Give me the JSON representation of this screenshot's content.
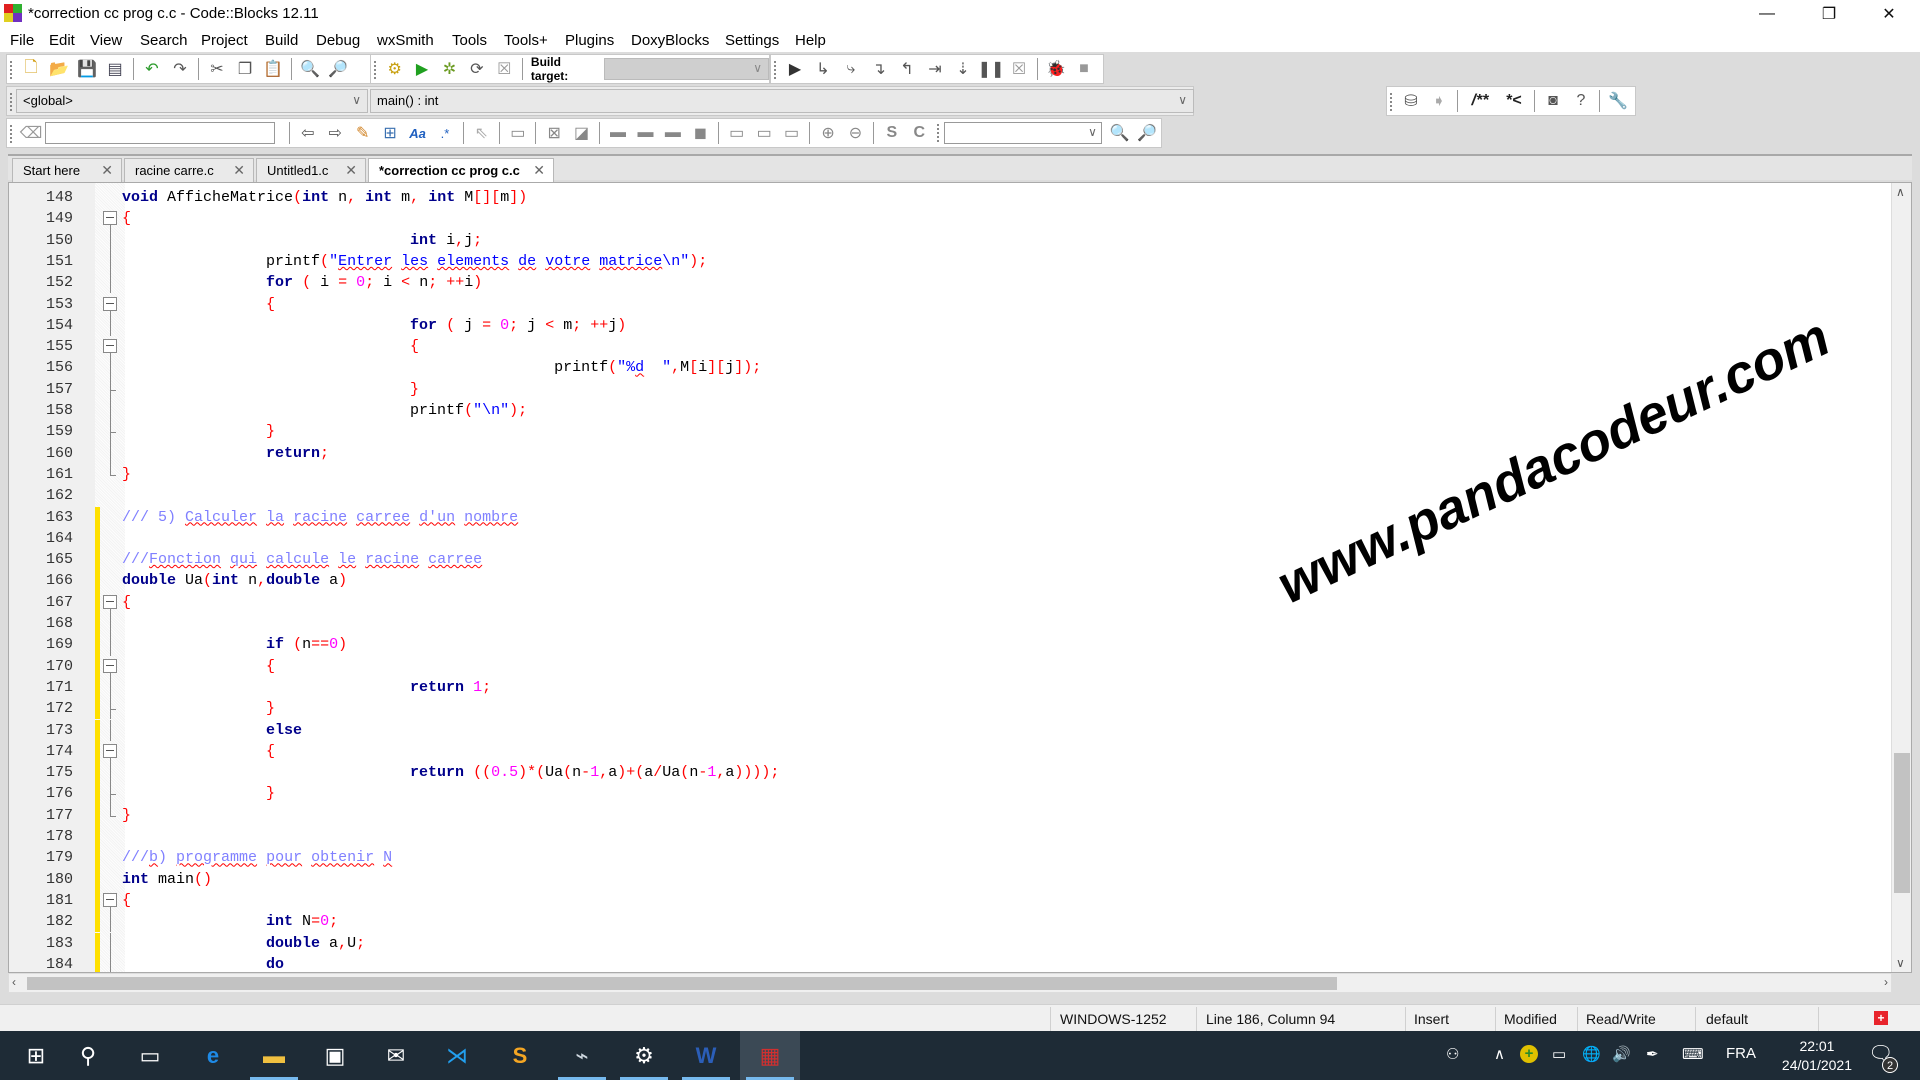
{
  "window": {
    "title": "*correction cc prog c.c - Code::Blocks 12.11",
    "minimize": "—",
    "maximize": "❐",
    "close": "✕"
  },
  "menu": [
    "File",
    "Edit",
    "View",
    "Search",
    "Project",
    "Build",
    "Debug",
    "wxSmith",
    "Tools",
    "Tools+",
    "Plugins",
    "DoxyBlocks",
    "Settings",
    "Help"
  ],
  "toolbar": {
    "build_target_label": "Build target:",
    "build_target_value": "",
    "scope_combo": "<global>",
    "function_combo": "main() : int",
    "search_value": "",
    "doxy_block_label": "/**",
    "doxy_line_label": "*<"
  },
  "tabs": [
    {
      "label": "Start here",
      "active": false
    },
    {
      "label": "racine carre.c",
      "active": false
    },
    {
      "label": "Untitled1.c",
      "active": false
    },
    {
      "label": "*correction cc prog c.c",
      "active": true
    }
  ],
  "tab_close": "✕",
  "editor": {
    "lines": [
      {
        "n": "148",
        "mark": false,
        "fold": "none",
        "html": "<span class='ty'>void</span> <span class='id'>AfficheMatrice</span><span class='op'>(</span><span class='ty'>int</span> n<span class='op'>,</span> <span class='ty'>int</span> m<span class='op'>,</span> <span class='ty'>int</span> M<span class='op'>[][</span>m<span class='op'>])</span>"
      },
      {
        "n": "149",
        "mark": false,
        "fold": "open",
        "html": "<span class='op'>{</span>"
      },
      {
        "n": "150",
        "mark": false,
        "fold": "line",
        "html": "                                <span class='ty'>int</span> i<span class='op'>,</span>j<span class='op'>;</span>"
      },
      {
        "n": "151",
        "mark": false,
        "fold": "line",
        "html": "                printf<span class='op'>(</span><span class='str'>\"<span class='sp'>Entrer</span> <span class='sp'>les</span> <span class='sp'>elements</span> <span class='sp'>de</span> <span class='sp'>votre</span> <span class='sp'>matrice</span>\\n\"</span><span class='op'>);</span>"
      },
      {
        "n": "152",
        "mark": false,
        "fold": "line",
        "html": "                <span class='kw'>for</span> <span class='op'>(</span> i <span class='op'>=</span> <span class='num'>0</span><span class='op'>;</span> i <span class='op'>&lt;</span> n<span class='op'>;</span> <span class='op'>++</span>i<span class='op'>)</span>"
      },
      {
        "n": "153",
        "mark": false,
        "fold": "open",
        "html": "                <span class='op'>{</span>"
      },
      {
        "n": "154",
        "mark": false,
        "fold": "line",
        "html": "                                <span class='kw'>for</span> <span class='op'>(</span> j <span class='op'>=</span> <span class='num'>0</span><span class='op'>;</span> j <span class='op'>&lt;</span> m<span class='op'>;</span> <span class='op'>++</span>j<span class='op'>)</span>"
      },
      {
        "n": "155",
        "mark": false,
        "fold": "open",
        "html": "                                <span class='op'>{</span>"
      },
      {
        "n": "156",
        "mark": false,
        "fold": "line",
        "html": "                                                printf<span class='op'>(</span><span class='str'>\"%<span class='sp'>d</span>  \"</span><span class='op'>,</span>M<span class='op'>[</span>i<span class='op'>][</span>j<span class='op'>]);</span>"
      },
      {
        "n": "157",
        "mark": false,
        "fold": "end",
        "html": "                                <span class='op'>}</span>"
      },
      {
        "n": "158",
        "mark": false,
        "fold": "line",
        "html": "                                printf<span class='op'>(</span><span class='str'>\"\\n\"</span><span class='op'>);</span>"
      },
      {
        "n": "159",
        "mark": false,
        "fold": "end",
        "html": "                <span class='op'>}</span>"
      },
      {
        "n": "160",
        "mark": false,
        "fold": "line",
        "html": "                <span class='kw'>return</span><span class='op'>;</span>"
      },
      {
        "n": "161",
        "mark": false,
        "fold": "last",
        "html": "<span class='op'>}</span>"
      },
      {
        "n": "162",
        "mark": false,
        "fold": "none",
        "html": ""
      },
      {
        "n": "163",
        "mark": true,
        "fold": "none",
        "html": "<span class='cm'>/// 5) <span class='sp'>Calculer</span> <span class='sp'>la</span> <span class='sp'>racine</span> <span class='sp'>carree</span> <span class='sp'>d'un</span> <span class='sp'>nombre</span></span>"
      },
      {
        "n": "164",
        "mark": true,
        "fold": "none",
        "html": ""
      },
      {
        "n": "165",
        "mark": true,
        "fold": "none",
        "html": "<span class='cm'>///<span class='sp'>Fonction</span> <span class='sp'>qui</span> <span class='sp'>calcule</span> <span class='sp'>le</span> <span class='sp'>racine</span> <span class='sp'>carree</span></span>"
      },
      {
        "n": "166",
        "mark": true,
        "fold": "none",
        "html": "<span class='ty'>double</span> Ua<span class='op'>(</span><span class='ty'>int</span> n<span class='op'>,</span><span class='ty'>double</span> a<span class='op'>)</span>"
      },
      {
        "n": "167",
        "mark": true,
        "fold": "open",
        "html": "<span class='op'>{</span>"
      },
      {
        "n": "168",
        "mark": true,
        "fold": "line",
        "html": ""
      },
      {
        "n": "169",
        "mark": true,
        "fold": "line",
        "html": "                <span class='kw'>if</span> <span class='op'>(</span>n<span class='op'>==</span><span class='num'>0</span><span class='op'>)</span>"
      },
      {
        "n": "170",
        "mark": true,
        "fold": "open",
        "html": "                <span class='op'>{</span>"
      },
      {
        "n": "171",
        "mark": true,
        "fold": "line",
        "html": "                                <span class='kw'>return</span> <span class='num'>1</span><span class='op'>;</span>"
      },
      {
        "n": "172",
        "mark": true,
        "fold": "end",
        "html": "                <span class='op'>}</span>"
      },
      {
        "n": "173",
        "mark": true,
        "fold": "line",
        "html": "                <span class='kw'>else</span>"
      },
      {
        "n": "174",
        "mark": true,
        "fold": "open",
        "html": "                <span class='op'>{</span>"
      },
      {
        "n": "175",
        "mark": true,
        "fold": "line",
        "html": "                                <span class='kw'>return</span> <span class='op'>((</span><span class='num'>0.5</span><span class='op'>)*(</span>Ua<span class='op'>(</span>n<span class='op'>-</span><span class='num'>1</span><span class='op'>,</span>a<span class='op'>)+(</span>a<span class='op'>/</span>Ua<span class='op'>(</span>n<span class='op'>-</span><span class='num'>1</span><span class='op'>,</span>a<span class='op'>))));</span>"
      },
      {
        "n": "176",
        "mark": true,
        "fold": "end",
        "html": "                <span class='op'>}</span>"
      },
      {
        "n": "177",
        "mark": true,
        "fold": "last",
        "html": "<span class='op'>}</span>"
      },
      {
        "n": "178",
        "mark": true,
        "fold": "none",
        "html": ""
      },
      {
        "n": "179",
        "mark": true,
        "fold": "none",
        "html": "<span class='cm'>///<span class='sp'>b</span>) <span class='sp'>programme</span> <span class='sp'>pour</span> <span class='sp'>obtenir</span> <span class='sp'>N</span></span>"
      },
      {
        "n": "180",
        "mark": true,
        "fold": "none",
        "html": "<span class='ty'>int</span> main<span class='op'>()</span>"
      },
      {
        "n": "181",
        "mark": true,
        "fold": "open",
        "html": "<span class='op'>{</span>"
      },
      {
        "n": "182",
        "mark": true,
        "fold": "line",
        "html": "                <span class='ty'>int</span> N<span class='op'>=</span><span class='num'>0</span><span class='op'>;</span>"
      },
      {
        "n": "183",
        "mark": true,
        "fold": "line",
        "html": "                <span class='ty'>double</span> a<span class='op'>,</span>U<span class='op'>;</span>"
      },
      {
        "n": "184",
        "mark": true,
        "fold": "line",
        "html": "                <span class='kw'>do</span>"
      }
    ]
  },
  "watermark": "www.pandacodeur.com",
  "status": {
    "encoding": "WINDOWS-1252",
    "position": "Line 186, Column 94",
    "mode": "Insert",
    "modified": "Modified",
    "access": "Read/Write",
    "lang": "default"
  },
  "taskbar": {
    "apps": [
      {
        "name": "start",
        "glyph": "⊞",
        "open": false,
        "active": false
      },
      {
        "name": "search",
        "glyph": "⚲",
        "open": false,
        "active": false
      },
      {
        "name": "task-view",
        "glyph": "▭",
        "open": false,
        "active": false
      },
      {
        "name": "edge",
        "glyph": "e",
        "open": false,
        "active": false
      },
      {
        "name": "file-explorer",
        "glyph": "▬",
        "open": true,
        "active": false
      },
      {
        "name": "store",
        "glyph": "▣",
        "open": false,
        "active": false
      },
      {
        "name": "mail",
        "glyph": "✉",
        "open": false,
        "active": false
      },
      {
        "name": "vscode",
        "glyph": "⋊",
        "open": false,
        "active": false
      },
      {
        "name": "sublime-text",
        "glyph": "S",
        "open": false,
        "active": false
      },
      {
        "name": "task-manager",
        "glyph": "⌁",
        "open": true,
        "active": false
      },
      {
        "name": "settings",
        "glyph": "⚙",
        "open": true,
        "active": false
      },
      {
        "name": "word",
        "glyph": "W",
        "open": true,
        "active": false
      },
      {
        "name": "codeblocks",
        "glyph": "▦",
        "open": true,
        "active": true
      }
    ],
    "language": "FRA",
    "time": "22:01",
    "date": "24/01/2021",
    "notifications": "2"
  }
}
